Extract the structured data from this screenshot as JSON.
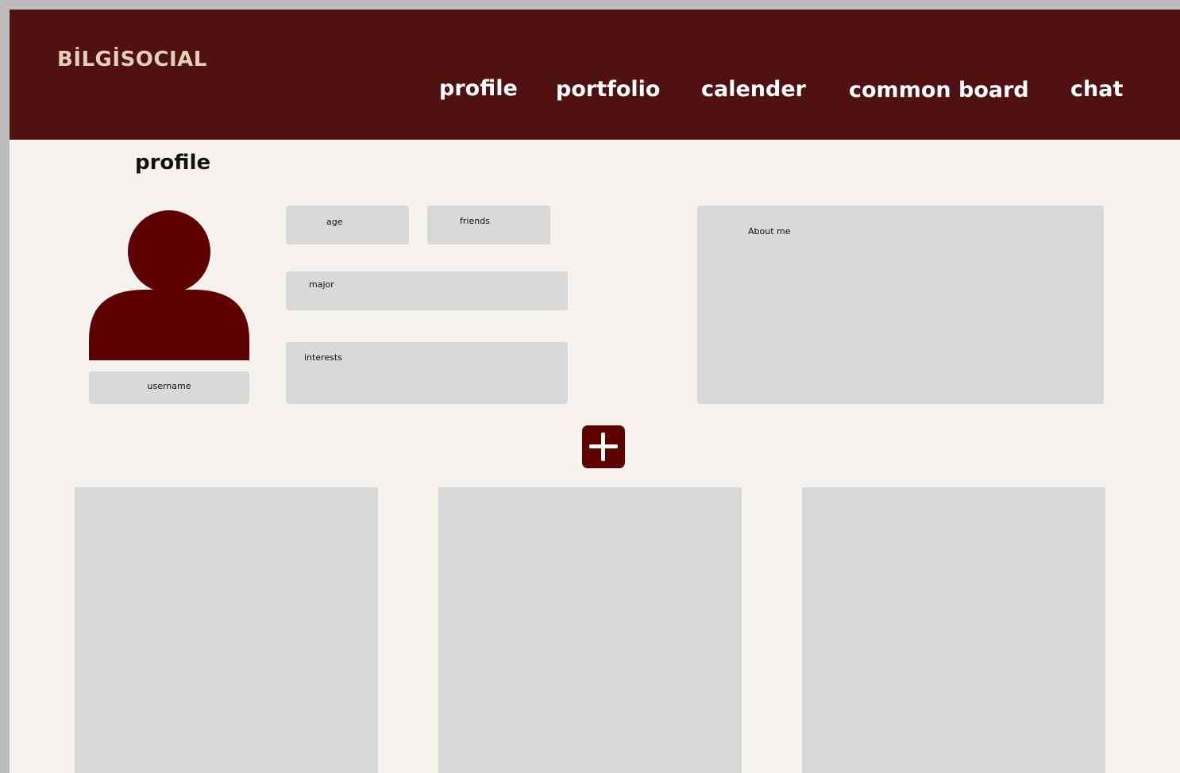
{
  "app": {
    "brand": "BİLGİSOCIAL"
  },
  "nav": {
    "items": [
      {
        "label": "profile"
      },
      {
        "label": "portfolio"
      },
      {
        "label": "calender"
      },
      {
        "label": "common board"
      },
      {
        "label": "chat"
      }
    ]
  },
  "page": {
    "title": "profile"
  },
  "profile": {
    "username_label": "username",
    "age_label": "age",
    "friends_label": "friends",
    "major_label": "major",
    "interests_label": "interests",
    "about_label": "About me"
  },
  "add_button": {
    "icon": "plus-icon"
  },
  "posts": {
    "cards": [
      {},
      {},
      {}
    ]
  },
  "colors": {
    "header_bg": "#501210",
    "brand_text": "#e6cfb5",
    "accent": "#5c0000",
    "page_bg": "#f6f3ee",
    "placeholder_box": "#d9d9d9"
  }
}
